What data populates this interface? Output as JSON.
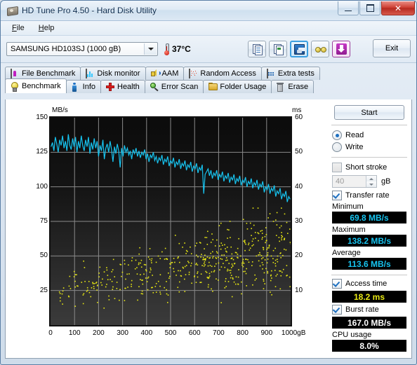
{
  "window": {
    "title": "HD Tune Pro 4.50 - Hard Disk Utility",
    "icon": "harddisk-icon",
    "minimize_label": "minimize-icon",
    "maximize_label": "maximize-icon",
    "close_label": "✕"
  },
  "menu": {
    "items": [
      {
        "label": "File",
        "accel": "F"
      },
      {
        "label": "Help",
        "accel": "H"
      }
    ]
  },
  "toolbar": {
    "drive_selected": "SAMSUNG HD103SJ (1000 gB)",
    "temperature": "37°C",
    "icons": [
      {
        "name": "copy-text-icon"
      },
      {
        "name": "copy-image-icon"
      },
      {
        "name": "save-icon"
      },
      {
        "name": "options-icon"
      },
      {
        "name": "download-icon"
      }
    ],
    "exit_label": "Exit"
  },
  "tabs": {
    "row1": [
      {
        "label": "File Benchmark",
        "icon": "file-benchmark-icon",
        "active": false
      },
      {
        "label": "Disk monitor",
        "icon": "disk-monitor-icon",
        "active": false
      },
      {
        "label": "AAM",
        "icon": "aam-speaker-icon",
        "active": false
      },
      {
        "label": "Random Access",
        "icon": "random-access-icon",
        "active": false
      },
      {
        "label": "Extra tests",
        "icon": "extra-tests-icon",
        "active": false
      }
    ],
    "row2": [
      {
        "label": "Benchmark",
        "icon": "benchmark-bulb-icon",
        "active": true
      },
      {
        "label": "Info",
        "icon": "info-icon",
        "active": false
      },
      {
        "label": "Health",
        "icon": "health-cross-icon",
        "active": false
      },
      {
        "label": "Error Scan",
        "icon": "error-scan-magnifier-icon",
        "active": false
      },
      {
        "label": "Folder Usage",
        "icon": "folder-usage-icon",
        "active": false
      },
      {
        "label": "Erase",
        "icon": "erase-trash-icon",
        "active": false
      }
    ]
  },
  "side": {
    "start_label": "Start",
    "read_label": "Read",
    "read_selected": true,
    "write_label": "Write",
    "write_selected": false,
    "short_stroke_label": "Short stroke",
    "short_stroke_checked": false,
    "short_stroke_value": "40",
    "short_stroke_unit": "gB",
    "transfer_rate_label": "Transfer rate",
    "transfer_rate_checked": true,
    "minimum_label": "Minimum",
    "minimum_value": "69.8 MB/s",
    "maximum_label": "Maximum",
    "maximum_value": "138.2 MB/s",
    "average_label": "Average",
    "average_value": "113.6 MB/s",
    "access_time_label": "Access time",
    "access_time_checked": true,
    "access_time_value": "18.2 ms",
    "burst_rate_label": "Burst rate",
    "burst_rate_checked": true,
    "burst_rate_value": "167.0 MB/s",
    "cpu_usage_label": "CPU usage",
    "cpu_usage_value": "8.0%",
    "colors": {
      "transfer_rate": "#17c4f0",
      "access_time": "#e8e813",
      "burst_rate": "#ffffff",
      "cpu_usage": "#ffffff"
    }
  },
  "chart_data": {
    "type": "line",
    "title": "",
    "xlabel": "gB",
    "ylabel": "MB/s",
    "y2label": "ms",
    "xlim": [
      0,
      1000
    ],
    "ylim": [
      0,
      150
    ],
    "y2lim": [
      0,
      60
    ],
    "grid": true,
    "xticks": [
      0,
      100,
      200,
      300,
      400,
      500,
      600,
      700,
      800,
      900,
      1000
    ],
    "xticklabels": [
      "0",
      "100",
      "200",
      "300",
      "400",
      "500",
      "600",
      "700",
      "800",
      "900",
      "1000gB"
    ],
    "yticks": [
      0,
      25,
      50,
      75,
      100,
      125,
      150
    ],
    "yticklabels": [
      "",
      "25",
      "50",
      "75",
      "100",
      "125",
      "150"
    ],
    "y2ticks": [
      0,
      10,
      20,
      30,
      40,
      50,
      60
    ],
    "y2ticklabels": [
      "",
      "10",
      "20",
      "30",
      "40",
      "50",
      "60"
    ],
    "series": [
      {
        "name": "Transfer rate",
        "type": "line",
        "color": "#17c4f0",
        "axis": "left",
        "unit": "MB/s",
        "x": [
          2,
          8,
          14,
          20,
          26,
          32,
          38,
          44,
          50,
          56,
          62,
          68,
          74,
          80,
          86,
          92,
          98,
          104,
          110,
          116,
          122,
          128,
          134,
          140,
          146,
          152,
          158,
          164,
          170,
          176,
          182,
          188,
          194,
          200,
          206,
          212,
          218,
          224,
          230,
          236,
          242,
          248,
          254,
          260,
          266,
          272,
          278,
          284,
          290,
          296,
          302,
          308,
          314,
          320,
          326,
          332,
          338,
          344,
          350,
          356,
          362,
          368,
          374,
          380,
          386,
          392,
          398,
          404,
          410,
          416,
          422,
          428,
          434,
          440,
          446,
          452,
          458,
          464,
          470,
          476,
          482,
          488,
          494,
          500,
          506,
          512,
          518,
          524,
          530,
          536,
          542,
          548,
          554,
          560,
          566,
          572,
          578,
          584,
          590,
          596,
          602,
          608,
          614,
          620,
          626,
          632,
          638,
          644,
          650,
          656,
          662,
          668,
          674,
          680,
          686,
          692,
          698,
          704,
          710,
          716,
          722,
          728,
          734,
          740,
          746,
          752,
          758,
          764,
          770,
          776,
          782,
          788,
          794,
          800,
          806,
          812,
          818,
          824,
          830,
          836,
          842,
          848,
          854,
          860,
          866,
          872,
          878,
          884,
          890,
          896,
          902,
          908,
          914,
          920,
          926,
          932,
          938,
          944,
          950,
          956,
          962,
          968,
          974,
          980,
          986,
          992,
          998
        ],
        "y": [
          129,
          132,
          126,
          136,
          131,
          125,
          134,
          130,
          137,
          128,
          133,
          126,
          138,
          130,
          127,
          135,
          129,
          136,
          125,
          133,
          128,
          137,
          130,
          126,
          134,
          129,
          136,
          124,
          132,
          127,
          135,
          128,
          133,
          122,
          130,
          126,
          134,
          120,
          128,
          131,
          125,
          133,
          127,
          118,
          129,
          124,
          131,
          126,
          114,
          128,
          122,
          130,
          125,
          128,
          123,
          126,
          120,
          127,
          124,
          128,
          122,
          126,
          121,
          125,
          123,
          127,
          120,
          124,
          118,
          123,
          121,
          125,
          119,
          122,
          117,
          121,
          119,
          123,
          116,
          120,
          118,
          122,
          115,
          119,
          117,
          121,
          114,
          118,
          116,
          120,
          113,
          117,
          115,
          119,
          112,
          116,
          114,
          118,
          111,
          115,
          113,
          117,
          110,
          114,
          112,
          116,
          95,
          109,
          111,
          113,
          108,
          112,
          106,
          110,
          108,
          112,
          105,
          109,
          107,
          111,
          104,
          108,
          106,
          110,
          103,
          107,
          105,
          109,
          102,
          106,
          104,
          108,
          101,
          105,
          103,
          107,
          100,
          104,
          102,
          106,
          99,
          103,
          101,
          105,
          98,
          102,
          100,
          104,
          96,
          100,
          98,
          102,
          95,
          99,
          97,
          101,
          93,
          97,
          95,
          99,
          91,
          95,
          93,
          97,
          89,
          93,
          91,
          95,
          72,
          76,
          74
        ]
      },
      {
        "name": "Access time",
        "type": "scatter",
        "color": "#e8e813",
        "axis": "right",
        "unit": "ms",
        "average_ms": 18.2,
        "n_points": 520,
        "description": "Random access latency samples rising from ~4-12 ms near LBA 0 to ~20-35 ms near the end of the disk"
      }
    ]
  }
}
